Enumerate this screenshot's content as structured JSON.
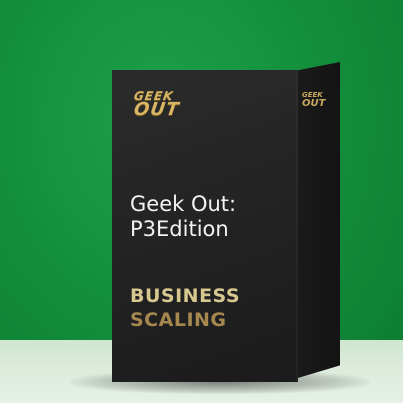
{
  "product": {
    "logo": {
      "line1": "GEEK",
      "line2": "OUT"
    },
    "side_logo": {
      "line1": "GEEK",
      "line2": "OUT"
    },
    "title": {
      "line1": "Geek Out:",
      "line2": "P3Edition"
    },
    "tagline": {
      "line1": "BUSINESS",
      "line2": "SCALING"
    }
  },
  "colors": {
    "background": "#13903c",
    "box": "#222222",
    "gold_light": "#d6c88f",
    "gold_dark": "#a5874f",
    "title_text": "#f3f3f3"
  }
}
